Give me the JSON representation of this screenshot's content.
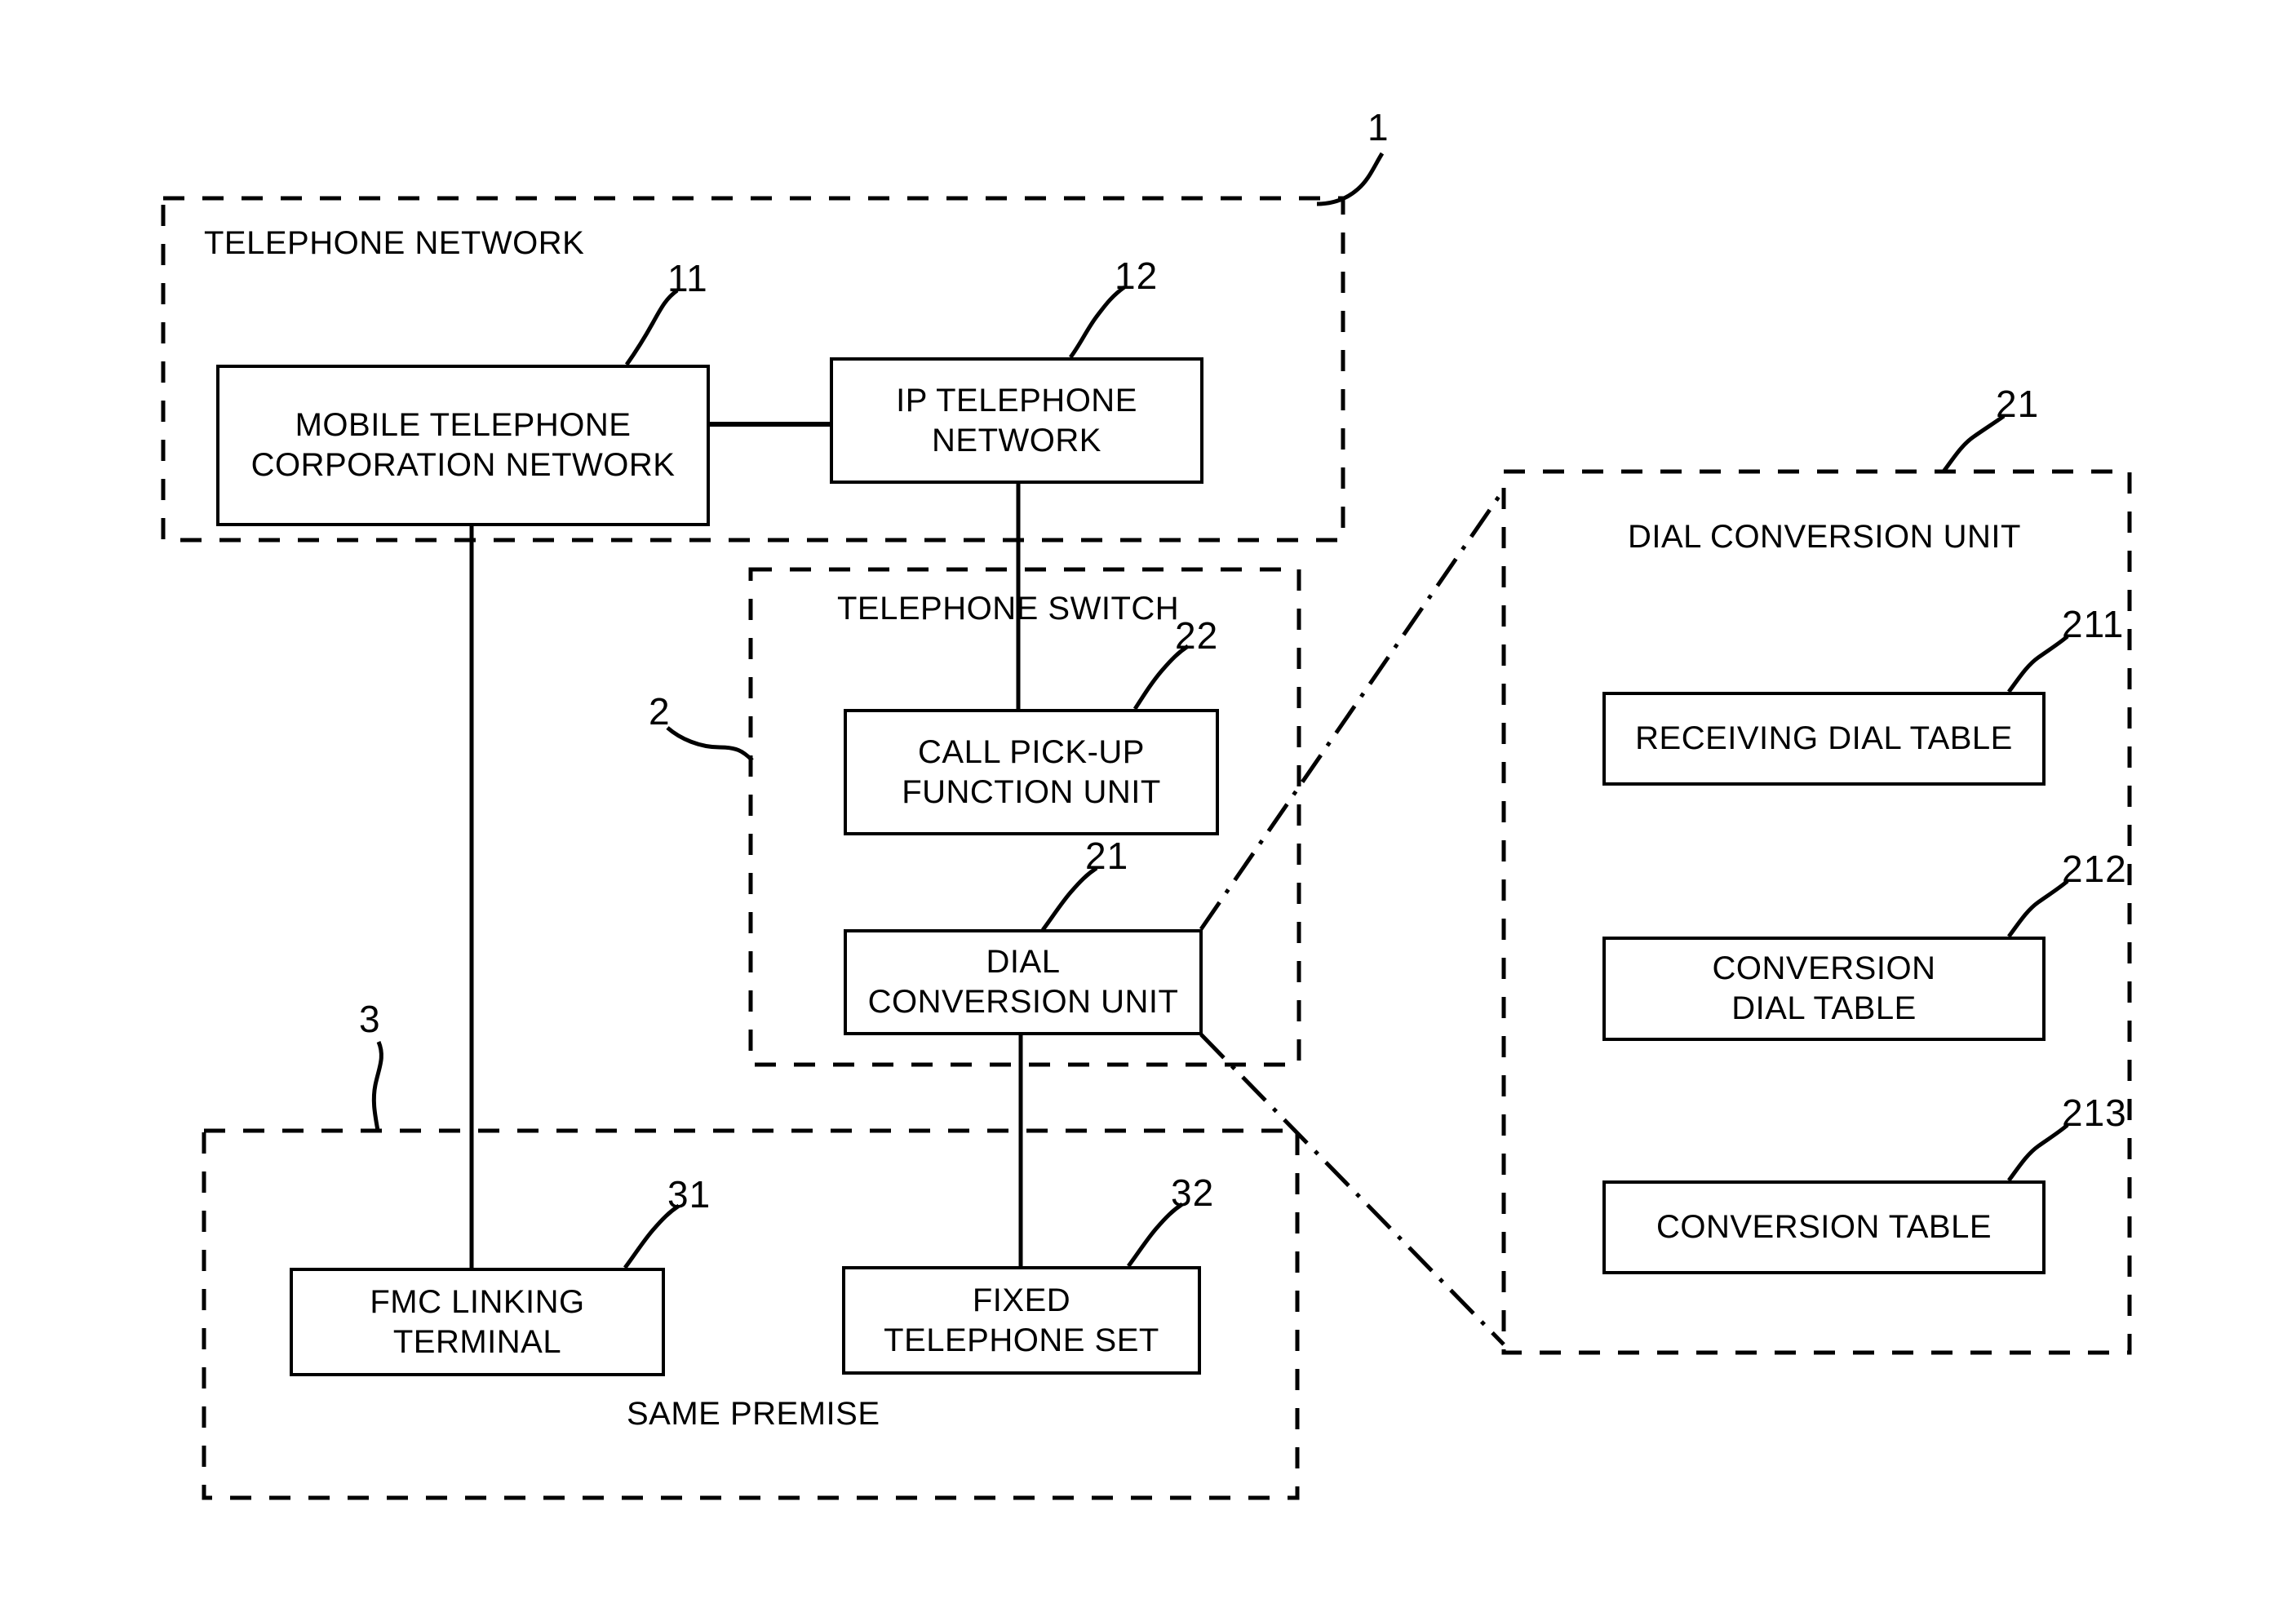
{
  "figure": {
    "type": "patent-block-diagram",
    "background_color": "#ffffff",
    "line_color": "#000000"
  },
  "groups": [
    {
      "id": "telephone-network",
      "caption": "TELEPHONE NETWORK",
      "ref": "1",
      "border_style": "dashed"
    },
    {
      "id": "telephone-switch",
      "caption": "TELEPHONE SWITCH",
      "ref": "2",
      "border_style": "dashed"
    },
    {
      "id": "same-premise",
      "caption": "SAME PREMISE",
      "ref": "3",
      "border_style": "dashed"
    },
    {
      "id": "dial-conversion-unit-detail",
      "caption": "DIAL CONVERSION UNIT",
      "ref": "21",
      "border_style": "dashed"
    }
  ],
  "blocks": [
    {
      "id": "mobile-telephone-corporation-network",
      "label": "MOBILE TELEPHONE\nCORPORATION NETWORK",
      "ref": "11",
      "group": "telephone-network"
    },
    {
      "id": "ip-telephone-network",
      "label": "IP TELEPHONE\nNETWORK",
      "ref": "12",
      "group": "telephone-network"
    },
    {
      "id": "call-pick-up-function-unit",
      "label": "CALL PICK-UP\nFUNCTION UNIT",
      "ref": "22",
      "group": "telephone-switch"
    },
    {
      "id": "dial-conversion-unit",
      "label": "DIAL\nCONVERSION UNIT",
      "ref": "21",
      "group": "telephone-switch"
    },
    {
      "id": "fmc-linking-terminal",
      "label": "FMC LINKING\nTERMINAL",
      "ref": "31",
      "group": "same-premise"
    },
    {
      "id": "fixed-telephone-set",
      "label": "FIXED\nTELEPHONE SET",
      "ref": "32",
      "group": "same-premise"
    },
    {
      "id": "receiving-dial-table",
      "label": "RECEIVING DIAL TABLE",
      "ref": "211",
      "group": "dial-conversion-unit-detail"
    },
    {
      "id": "conversion-dial-table",
      "label": "CONVERSION\nDIAL TABLE",
      "ref": "212",
      "group": "dial-conversion-unit-detail"
    },
    {
      "id": "conversion-table",
      "label": "CONVERSION TABLE",
      "ref": "213",
      "group": "dial-conversion-unit-detail"
    }
  ],
  "connections": [
    {
      "from": "mobile-telephone-corporation-network",
      "to": "ip-telephone-network",
      "style": "solid"
    },
    {
      "from": "mobile-telephone-corporation-network",
      "to": "fmc-linking-terminal",
      "style": "solid"
    },
    {
      "from": "ip-telephone-network",
      "to": "call-pick-up-function-unit",
      "style": "solid"
    },
    {
      "from": "dial-conversion-unit",
      "to": "fixed-telephone-set",
      "style": "solid"
    },
    {
      "from": "dial-conversion-unit",
      "to": "dial-conversion-unit-detail",
      "style": "chain"
    }
  ],
  "refs": {
    "r1": "1",
    "r2": "2",
    "r3": "3",
    "r11": "11",
    "r12": "12",
    "r21_switch": "21",
    "r21_panel": "21",
    "r22": "22",
    "r31": "31",
    "r32": "32",
    "r211": "211",
    "r212": "212",
    "r213": "213"
  },
  "text": {
    "telephone_network_caption": "TELEPHONE NETWORK",
    "telephone_switch_caption": "TELEPHONE SWITCH",
    "same_premise_caption": "SAME PREMISE",
    "dial_conversion_unit_caption": "DIAL CONVERSION UNIT",
    "mobile_telephone_corporation_network": "MOBILE TELEPHONE\nCORPORATION NETWORK",
    "ip_telephone_network": "IP TELEPHONE\nNETWORK",
    "call_pick_up_function_unit": "CALL PICK-UP\nFUNCTION UNIT",
    "dial_conversion_unit": "DIAL\nCONVERSION UNIT",
    "fmc_linking_terminal": "FMC LINKING\nTERMINAL",
    "fixed_telephone_set": "FIXED\nTELEPHONE SET",
    "receiving_dial_table": "RECEIVING DIAL TABLE",
    "conversion_dial_table": "CONVERSION\nDIAL TABLE",
    "conversion_table": "CONVERSION TABLE"
  }
}
